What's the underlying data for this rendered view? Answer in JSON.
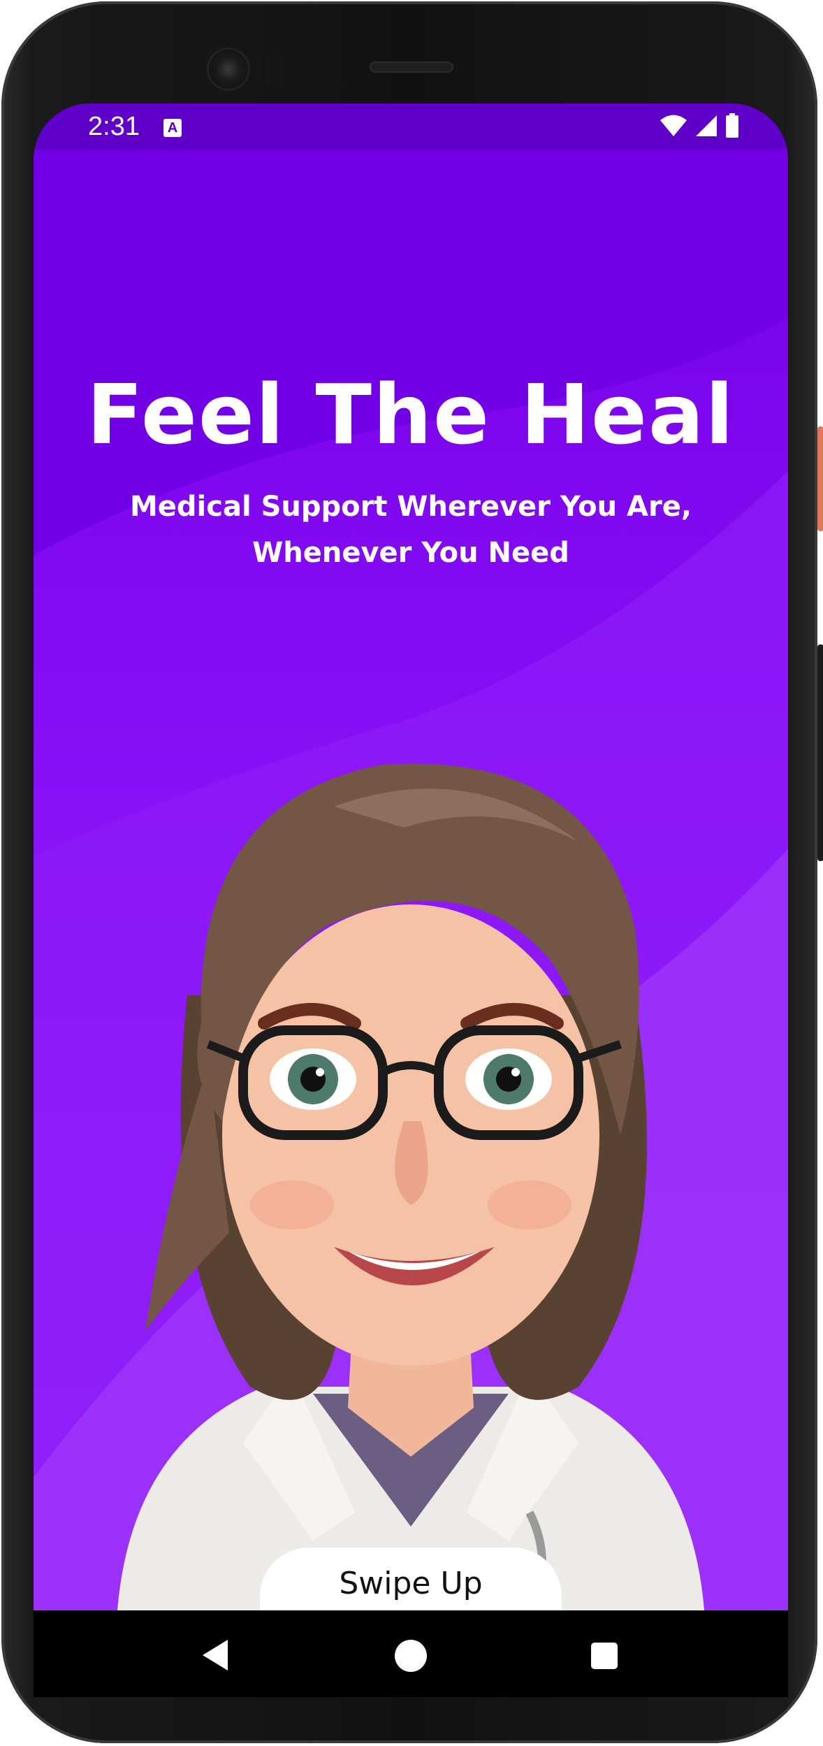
{
  "status_bar": {
    "time": "2:31",
    "notification_icon": "a-badge-icon",
    "icons": [
      "wifi-icon",
      "signal-icon",
      "battery-icon"
    ]
  },
  "splash": {
    "title": "Feel The Heal",
    "subtitle_line1": "Medical Support Wherever You Are,",
    "subtitle_line2": "Whenever You Need",
    "illustration": "doctor-avatar-illustration",
    "swipe_label": "Swipe Up"
  },
  "nav_bar": {
    "icons": [
      "back-icon",
      "home-icon",
      "recents-icon"
    ]
  },
  "colors": {
    "primary": "#7400e6",
    "status_bar": "#5f00c8",
    "accent_light": "#9a2cfa",
    "text_on_primary": "#ffffff"
  }
}
